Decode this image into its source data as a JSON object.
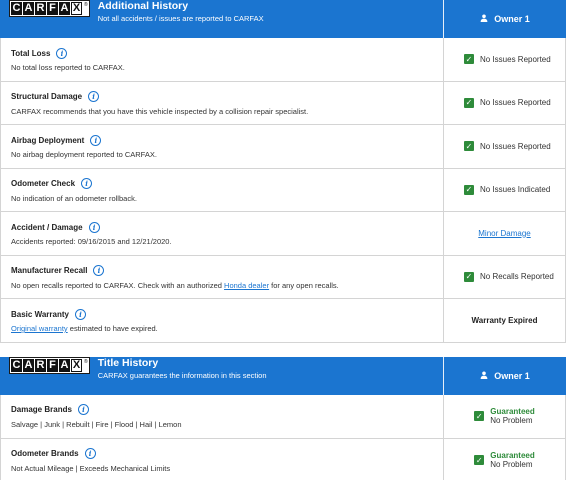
{
  "additional_history": {
    "logo_letters": [
      "C",
      "A",
      "R",
      "F",
      "A",
      "X"
    ],
    "title": "Additional History",
    "subtitle": "Not all accidents / issues are reported to CARFAX",
    "owner_label": "Owner 1",
    "rows": [
      {
        "title": "Total Loss",
        "desc": "No total loss reported to CARFAX.",
        "status": "No Issues Reported"
      },
      {
        "title": "Structural Damage",
        "desc": "CARFAX recommends that you have this vehicle inspected by a collision repair specialist.",
        "status": "No Issues Reported"
      },
      {
        "title": "Airbag Deployment",
        "desc": "No airbag deployment reported to CARFAX.",
        "status": "No Issues Reported"
      },
      {
        "title": "Odometer Check",
        "desc": "No indication of an odometer rollback.",
        "status": "No Issues Indicated"
      },
      {
        "title": "Accident / Damage",
        "desc": "Accidents reported: 09/16/2015 and 12/21/2020.",
        "status": "Minor Damage"
      },
      {
        "title": "Manufacturer Recall",
        "desc_pre": "No open recalls reported to CARFAX. Check with an authorized ",
        "desc_link": "Honda dealer",
        "desc_post": " for any open recalls.",
        "status": "No Recalls Reported"
      },
      {
        "title": "Basic Warranty",
        "desc_link": "Original warranty",
        "desc_post": " estimated to have expired.",
        "status": "Warranty Expired"
      }
    ]
  },
  "title_history": {
    "logo_letters": [
      "C",
      "A",
      "R",
      "F",
      "A",
      "X"
    ],
    "title": "Title History",
    "subtitle": "CARFAX guarantees the information in this section",
    "owner_label": "Owner 1",
    "rows": [
      {
        "title": "Damage Brands",
        "desc": "Salvage | Junk | Rebuilt | Fire | Flood | Hail | Lemon",
        "status_top": "Guaranteed",
        "status_bottom": "No Problem"
      },
      {
        "title": "Odometer Brands",
        "desc": "Not Actual Mileage | Exceeds Mechanical Limits",
        "status_top": "Guaranteed",
        "status_bottom": "No Problem"
      }
    ]
  },
  "colors": {
    "header_blue": "#1b75d0",
    "check_green": "#2e8b3a"
  },
  "icons": {
    "info": "info-circle-icon",
    "check": "checkbox-checked-icon",
    "owner": "person-icon"
  }
}
